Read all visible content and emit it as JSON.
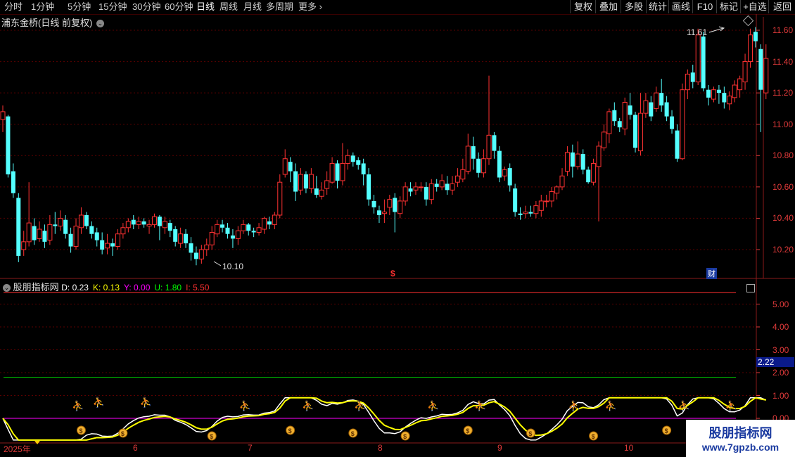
{
  "toolbar": {
    "periods": [
      "分时",
      "1分钟",
      "5分钟",
      "15分钟",
      "30分钟",
      "60分钟",
      "日线",
      "周线",
      "月线",
      "多周期",
      "更多"
    ],
    "active_period": "日线",
    "buttons": [
      "复权",
      "叠加",
      "多股",
      "统计",
      "画线",
      "F10",
      "标记",
      "+自选",
      "返回"
    ]
  },
  "main": {
    "title": "浦东金桥(日线 前复权)",
    "high_label": "11.61",
    "low_label": "10.10",
    "y_ticks": [
      "11.60",
      "11.40",
      "11.20",
      "11.00",
      "10.80",
      "10.60",
      "10.40",
      "10.20"
    ],
    "marker_dollar": "$",
    "marker_cai": "财"
  },
  "indicator": {
    "name": "股朋指标网",
    "values": [
      {
        "label": "D:",
        "value": "0.23",
        "color": "#ffffff"
      },
      {
        "label": "K:",
        "value": "0.13",
        "color": "#ffff00"
      },
      {
        "label": "Y:",
        "value": "0.00",
        "color": "#ff00ff"
      },
      {
        "label": "U:",
        "value": "1.80",
        "color": "#00ff00"
      },
      {
        "label": "I:",
        "value": "5.50",
        "color": "#ff3030"
      }
    ],
    "y_ticks": [
      "5.00",
      "4.00",
      "3.00",
      "2.00",
      "1.00",
      "0.00"
    ],
    "current_value": "2.22"
  },
  "x_axis": [
    "2025年",
    "6",
    "7",
    "8",
    "9",
    "10"
  ],
  "watermark": {
    "title": "股朋指标网",
    "url": "www.7gpzb.com"
  },
  "colors": {
    "up": "#ff3232",
    "down": "#54ffff",
    "grid": "#5a0000",
    "axis": "#e03a3a"
  },
  "chart_data": {
    "type": "candlestick",
    "title": "浦东金桥(日线 前复权)",
    "ylim": [
      10.05,
      11.75
    ],
    "candles": [
      [
        11.03,
        11.08,
        11.12,
        10.95
      ],
      [
        11.05,
        10.68,
        11.06,
        10.66
      ],
      [
        10.7,
        10.56,
        10.75,
        10.53
      ],
      [
        10.53,
        10.16,
        10.56,
        10.12
      ],
      [
        10.2,
        10.25,
        10.32,
        10.16
      ],
      [
        10.25,
        10.37,
        10.63,
        10.22
      ],
      [
        10.35,
        10.26,
        10.4,
        10.23
      ],
      [
        10.27,
        10.33,
        10.38,
        10.25
      ],
      [
        10.32,
        10.25,
        10.36,
        10.21
      ],
      [
        10.26,
        10.36,
        10.42,
        10.23
      ],
      [
        10.36,
        10.35,
        10.44,
        10.3
      ],
      [
        10.35,
        10.4,
        10.45,
        10.32
      ],
      [
        10.39,
        10.3,
        10.42,
        10.27
      ],
      [
        10.3,
        10.22,
        10.34,
        10.18
      ],
      [
        10.22,
        10.35,
        10.4,
        10.2
      ],
      [
        10.34,
        10.42,
        10.47,
        10.3
      ],
      [
        10.42,
        10.35,
        10.44,
        10.33
      ],
      [
        10.35,
        10.3,
        10.38,
        10.27
      ],
      [
        10.31,
        10.26,
        10.34,
        10.22
      ],
      [
        10.26,
        10.2,
        10.31,
        10.17
      ],
      [
        10.21,
        10.24,
        10.3,
        10.17
      ],
      [
        10.24,
        10.22,
        10.27,
        10.16
      ],
      [
        10.22,
        10.3,
        10.33,
        10.2
      ],
      [
        10.3,
        10.34,
        10.37,
        10.27
      ],
      [
        10.34,
        10.38,
        10.4,
        10.31
      ],
      [
        10.39,
        10.36,
        10.42,
        10.33
      ],
      [
        10.36,
        10.38,
        10.41,
        10.33
      ],
      [
        10.38,
        10.36,
        10.4,
        10.34
      ],
      [
        10.35,
        10.36,
        10.39,
        10.3
      ],
      [
        10.36,
        10.41,
        10.43,
        10.34
      ],
      [
        10.41,
        10.35,
        10.42,
        10.26
      ],
      [
        10.34,
        10.38,
        10.41,
        10.3
      ],
      [
        10.37,
        10.32,
        10.39,
        10.28
      ],
      [
        10.33,
        10.25,
        10.35,
        10.22
      ],
      [
        10.24,
        10.3,
        10.34,
        10.21
      ],
      [
        10.3,
        10.24,
        10.33,
        10.21
      ],
      [
        10.24,
        10.18,
        10.28,
        10.13
      ],
      [
        10.18,
        10.14,
        10.22,
        10.1
      ],
      [
        10.14,
        10.2,
        10.23,
        10.11
      ],
      [
        10.2,
        10.23,
        10.27,
        10.16
      ],
      [
        10.23,
        10.31,
        10.35,
        10.2
      ],
      [
        10.3,
        10.36,
        10.39,
        10.28
      ],
      [
        10.36,
        10.34,
        10.39,
        10.31
      ],
      [
        10.34,
        10.3,
        10.37,
        10.27
      ],
      [
        10.29,
        10.27,
        10.33,
        10.21
      ],
      [
        10.27,
        10.32,
        10.35,
        10.23
      ],
      [
        10.32,
        10.36,
        10.39,
        10.3
      ],
      [
        10.36,
        10.32,
        10.37,
        10.29
      ],
      [
        10.32,
        10.31,
        10.34,
        10.28
      ],
      [
        10.31,
        10.34,
        10.37,
        10.29
      ],
      [
        10.33,
        10.4,
        10.41,
        10.3
      ],
      [
        10.38,
        10.36,
        10.41,
        10.33
      ],
      [
        10.36,
        10.42,
        10.44,
        10.33
      ],
      [
        10.42,
        10.63,
        10.68,
        10.4
      ],
      [
        10.68,
        10.78,
        10.84,
        10.66
      ],
      [
        10.76,
        10.7,
        10.79,
        10.63
      ],
      [
        10.7,
        10.57,
        10.75,
        10.51
      ],
      [
        10.58,
        10.68,
        10.72,
        10.55
      ],
      [
        10.68,
        10.59,
        10.7,
        10.56
      ],
      [
        10.59,
        10.68,
        10.72,
        10.56
      ],
      [
        10.59,
        10.55,
        10.67,
        10.53
      ],
      [
        10.54,
        10.58,
        10.63,
        10.52
      ],
      [
        10.59,
        10.64,
        10.7,
        10.55
      ],
      [
        10.63,
        10.75,
        10.79,
        10.62
      ],
      [
        10.75,
        10.64,
        10.77,
        10.59
      ],
      [
        10.64,
        10.75,
        10.88,
        10.61
      ],
      [
        10.75,
        10.8,
        10.84,
        10.71
      ],
      [
        10.8,
        10.76,
        10.82,
        10.73
      ],
      [
        10.77,
        10.74,
        10.79,
        10.71
      ],
      [
        10.75,
        10.68,
        10.78,
        10.61
      ],
      [
        10.68,
        10.52,
        10.72,
        10.48
      ],
      [
        10.51,
        10.47,
        10.55,
        10.43
      ],
      [
        10.45,
        10.42,
        10.48,
        10.37
      ],
      [
        10.43,
        10.44,
        10.52,
        10.37
      ],
      [
        10.47,
        10.52,
        10.55,
        10.42
      ],
      [
        10.53,
        10.44,
        10.56,
        10.31
      ],
      [
        10.43,
        10.51,
        10.54,
        10.4
      ],
      [
        10.51,
        10.6,
        10.63,
        10.48
      ],
      [
        10.59,
        10.57,
        10.63,
        10.54
      ],
      [
        10.58,
        10.6,
        10.63,
        10.55
      ],
      [
        10.6,
        10.6,
        10.63,
        10.57
      ],
      [
        10.6,
        10.52,
        10.63,
        10.48
      ],
      [
        10.52,
        10.62,
        10.65,
        10.49
      ],
      [
        10.62,
        10.6,
        10.65,
        10.57
      ],
      [
        10.6,
        10.64,
        10.68,
        10.58
      ],
      [
        10.62,
        10.58,
        10.67,
        10.55
      ],
      [
        10.58,
        10.62,
        10.67,
        10.55
      ],
      [
        10.63,
        10.67,
        10.72,
        10.6
      ],
      [
        10.65,
        10.71,
        10.78,
        10.63
      ],
      [
        10.7,
        10.86,
        10.94,
        10.68
      ],
      [
        10.86,
        10.78,
        10.92,
        10.71
      ],
      [
        10.78,
        10.69,
        10.82,
        10.66
      ],
      [
        10.69,
        10.78,
        10.84,
        10.66
      ],
      [
        10.78,
        10.93,
        11.31,
        10.74
      ],
      [
        10.93,
        10.83,
        10.95,
        10.78
      ],
      [
        10.83,
        10.66,
        10.86,
        10.63
      ],
      [
        10.67,
        10.71,
        10.73,
        10.64
      ],
      [
        10.72,
        10.61,
        10.75,
        10.57
      ],
      [
        10.59,
        10.44,
        10.62,
        10.41
      ],
      [
        10.43,
        10.42,
        10.47,
        10.39
      ],
      [
        10.43,
        10.44,
        10.48,
        10.4
      ],
      [
        10.44,
        10.43,
        10.48,
        10.41
      ],
      [
        10.43,
        10.48,
        10.51,
        10.4
      ],
      [
        10.45,
        10.51,
        10.55,
        10.41
      ],
      [
        10.51,
        10.51,
        10.55,
        10.47
      ],
      [
        10.51,
        10.57,
        10.6,
        10.47
      ],
      [
        10.56,
        10.6,
        10.61,
        10.52
      ],
      [
        10.6,
        10.67,
        10.72,
        10.58
      ],
      [
        10.7,
        10.82,
        10.86,
        10.67
      ],
      [
        10.82,
        10.73,
        10.87,
        10.66
      ],
      [
        10.73,
        10.81,
        10.89,
        10.71
      ],
      [
        10.81,
        10.71,
        10.84,
        10.68
      ],
      [
        10.71,
        10.63,
        10.73,
        10.62
      ],
      [
        10.63,
        10.75,
        10.78,
        10.61
      ],
      [
        10.73,
        10.86,
        10.89,
        10.38
      ],
      [
        10.85,
        10.95,
        11.0,
        10.83
      ],
      [
        10.94,
        11.08,
        11.1,
        10.88
      ],
      [
        11.09,
        11.02,
        11.14,
        10.99
      ],
      [
        11.02,
        10.98,
        11.04,
        10.95
      ],
      [
        10.97,
        11.14,
        11.17,
        10.93
      ],
      [
        11.12,
        11.06,
        11.2,
        11.03
      ],
      [
        11.06,
        10.85,
        11.08,
        10.82
      ],
      [
        10.83,
        11.07,
        11.2,
        10.8
      ],
      [
        11.07,
        11.15,
        11.2,
        11.04
      ],
      [
        11.14,
        11.05,
        11.18,
        11.02
      ],
      [
        11.1,
        11.2,
        11.24,
        11.08
      ],
      [
        11.2,
        11.12,
        11.29,
        11.08
      ],
      [
        11.14,
        11.05,
        11.18,
        11.02
      ],
      [
        11.05,
        10.97,
        11.09,
        10.94
      ],
      [
        10.96,
        10.78,
        11.0,
        10.76
      ],
      [
        10.78,
        11.22,
        11.26,
        10.77
      ],
      [
        11.22,
        11.32,
        11.35,
        11.16
      ],
      [
        11.33,
        11.27,
        11.38,
        11.23
      ],
      [
        11.27,
        11.57,
        11.61,
        11.25
      ],
      [
        11.56,
        11.23,
        11.59,
        11.21
      ],
      [
        11.22,
        11.17,
        11.25,
        11.12
      ],
      [
        11.16,
        11.22,
        11.24,
        11.14
      ],
      [
        11.22,
        11.2,
        11.25,
        11.13
      ],
      [
        11.2,
        11.14,
        11.24,
        11.1
      ],
      [
        11.13,
        11.18,
        11.21,
        11.09
      ],
      [
        11.17,
        11.25,
        11.28,
        11.14
      ],
      [
        11.22,
        11.29,
        11.31,
        11.17
      ],
      [
        11.27,
        11.4,
        11.45,
        11.22
      ],
      [
        11.4,
        11.57,
        11.61,
        11.36
      ],
      [
        11.59,
        11.53,
        11.62,
        11.49
      ],
      [
        11.48,
        11.22,
        11.51,
        10.95
      ],
      [
        11.2,
        11.42,
        11.51,
        11.16
      ]
    ]
  }
}
